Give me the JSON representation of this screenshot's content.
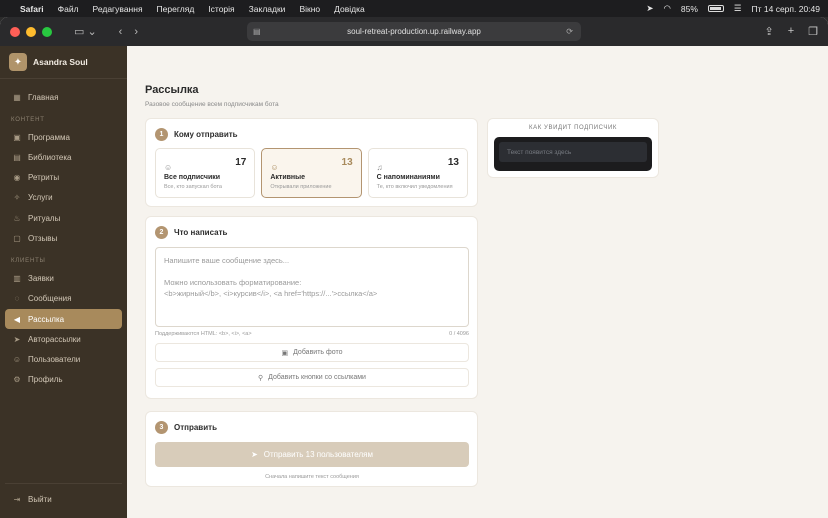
{
  "menubar": {
    "app": "Safari",
    "items": [
      "Файл",
      "Редагування",
      "Перегляд",
      "Історія",
      "Закладки",
      "Вікно",
      "Довідка"
    ],
    "battery": "85%",
    "datetime": "Пт 14 серп.  20:49"
  },
  "browser": {
    "url": "soul-retreat-production.up.railway.app"
  },
  "sidebar": {
    "brand": "Asandra Soul",
    "home": "Главная",
    "section_content": "КОНТЕНТ",
    "content_items": [
      "Программа",
      "Библиотека",
      "Ретриты",
      "Услуги",
      "Ритуалы",
      "Отзывы"
    ],
    "section_clients": "КЛИЕНТЫ",
    "client_items": [
      "Заявки",
      "Сообщения",
      "Рассылка",
      "Авторассылки",
      "Пользователи",
      "Профиль"
    ],
    "active": "Рассылка",
    "logout": "Выйти"
  },
  "page": {
    "title": "Рассылка",
    "subtitle": "Разовое сообщение всем подписчикам бота"
  },
  "step1": {
    "num": "1",
    "title": "Кому отправить",
    "audiences": [
      {
        "title": "Все подписчики",
        "desc": "Все, кто запускал бота",
        "count": "17"
      },
      {
        "title": "Активные",
        "desc": "Открывали приложение",
        "count": "13"
      },
      {
        "title": "С напоминаниями",
        "desc": "Те, кто включил уведомления",
        "count": "13"
      }
    ]
  },
  "step2": {
    "num": "2",
    "title": "Что написать",
    "placeholder_line1": "Напишите ваше сообщение здесь...",
    "placeholder_line2": "Можно использовать форматирование:",
    "placeholder_line3": "<b>жирный</b>, <i>курсив</i>, <a href='https://...'>ссылка</a>",
    "html_hint": "Поддерживаются HTML: <b>, <i>, <a>",
    "counter": "0 / 4096",
    "add_photo": "Добавить фото",
    "add_buttons": "Добавить кнопки со ссылками"
  },
  "step3": {
    "num": "3",
    "title": "Отправить",
    "send_label": "Отправить 13 пользователям",
    "hint": "Сначала напишите текст сообщения"
  },
  "preview": {
    "label": "КАК УВИДИТ ПОДПИСЧИК",
    "placeholder": "Текст появится здесь"
  },
  "colors": {
    "accent": "#b39571",
    "sidebar_bg": "#3b3226",
    "active_item": "#a88a5c"
  }
}
